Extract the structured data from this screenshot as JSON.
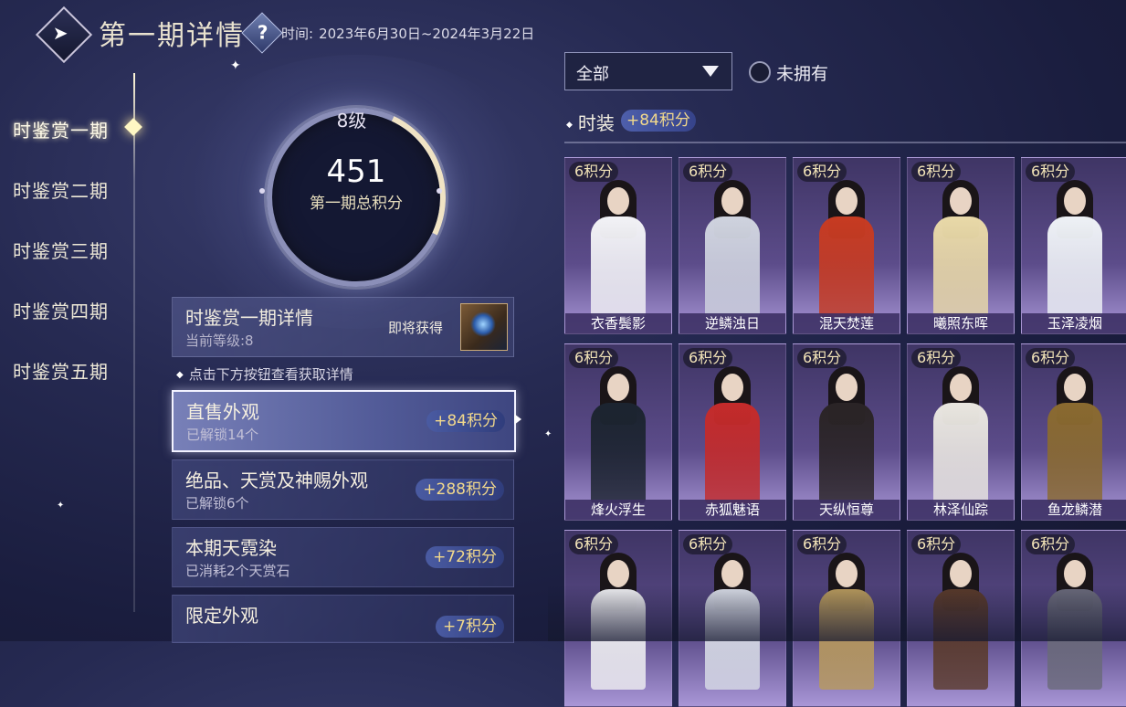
{
  "header": {
    "title": "第一期详情",
    "time_label": "时间:",
    "time_range": "2023年6月30日~2024年3月22日"
  },
  "nav": {
    "items": [
      {
        "label": "时鉴赏一期"
      },
      {
        "label": "时鉴赏二期"
      },
      {
        "label": "时鉴赏三期"
      },
      {
        "label": "时鉴赏四期"
      },
      {
        "label": "时鉴赏五期"
      }
    ],
    "active_index": 0
  },
  "progress": {
    "level": "8级",
    "score": "451",
    "score_label": "第一期总积分"
  },
  "detail": {
    "title": "时鉴赏一期详情",
    "current_level": "当前等级:8",
    "coming_label": "即将获得"
  },
  "hint": "点击下方按钮查看获取详情",
  "categories": [
    {
      "title": "直售外观",
      "sub": "已解锁14个",
      "points": "+84积分",
      "active": true
    },
    {
      "title": "绝品、天赏及神赐外观",
      "sub": "已解锁6个",
      "points": "+288积分",
      "active": false
    },
    {
      "title": "本期天霓染",
      "sub": "已消耗2个天赏石",
      "points": "+72积分",
      "active": false
    },
    {
      "title": "限定外观",
      "sub": "",
      "points": "+7积分",
      "active": false
    }
  ],
  "filter": {
    "selected": "全部",
    "radio_label": "未拥有"
  },
  "section": {
    "title": "时装",
    "points": "+84积分"
  },
  "outfits": [
    {
      "points": "6积分",
      "name": "衣香鬓影",
      "color": "#f2f2f6"
    },
    {
      "points": "6积分",
      "name": "逆鳞浊日",
      "color": "#cfd3df"
    },
    {
      "points": "6积分",
      "name": "混天焚莲",
      "color": "#c73b22"
    },
    {
      "points": "6积分",
      "name": "曦照东晖",
      "color": "#e9d9a8"
    },
    {
      "points": "6积分",
      "name": "玉泽凌烟",
      "color": "#eef1f6"
    },
    {
      "points": "6积分",
      "name": "烽火浮生",
      "color": "#1c2430"
    },
    {
      "points": "6积分",
      "name": "赤狐魅语",
      "color": "#c42b2b"
    },
    {
      "points": "6积分",
      "name": "天纵恒尊",
      "color": "#2a2426"
    },
    {
      "points": "6积分",
      "name": "林泽仙踪",
      "color": "#e9e6e0"
    },
    {
      "points": "6积分",
      "name": "鱼龙鳞潜",
      "color": "#8a6a30"
    },
    {
      "points": "6积分",
      "name": "",
      "color": "#f0f0f2"
    },
    {
      "points": "6积分",
      "name": "",
      "color": "#d8dce6"
    },
    {
      "points": "6积分",
      "name": "",
      "color": "#b89a5c"
    },
    {
      "points": "6积分",
      "name": "",
      "color": "#5a3a2a"
    },
    {
      "points": "6积分",
      "name": "",
      "color": "#6a6a7a"
    }
  ]
}
